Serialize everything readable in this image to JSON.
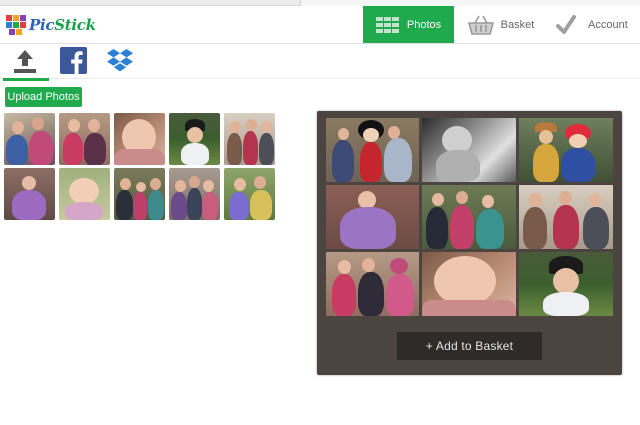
{
  "app": {
    "logo_text_a": "Pic",
    "logo_text_b": "Stick"
  },
  "nav": {
    "photos": "Photos",
    "basket": "Basket",
    "account": "Account"
  },
  "sources": [
    "upload",
    "facebook",
    "dropbox"
  ],
  "upload_button": "Upload Photos",
  "panel": {
    "add_button": "+ Add to Basket"
  },
  "colors": {
    "accent": "#1faa4d",
    "panel": "#4b4440",
    "button_dark": "#2f2b29"
  }
}
